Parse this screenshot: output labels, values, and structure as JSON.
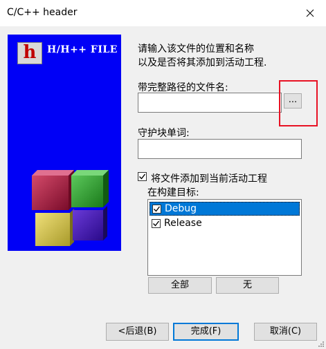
{
  "window": {
    "title": "C/C++ header"
  },
  "side_image": {
    "logo_letter": "h",
    "logo_text": "H/H++ FILE"
  },
  "description": {
    "line1": "请输入该文件的位置和名称",
    "line2": "以及是否将其添加到活动工程."
  },
  "file_path": {
    "label": "带完整路径的文件名:",
    "value": "",
    "browse_label": "..."
  },
  "guard_word": {
    "label": "守护块单词:",
    "value": ""
  },
  "add_to_project": {
    "label": "将文件添加到当前活动工程",
    "checked": true
  },
  "build_targets": {
    "label": "在构建目标:",
    "items": [
      {
        "label": "Debug",
        "checked": true,
        "selected": true
      },
      {
        "label": "Release",
        "checked": true,
        "selected": false
      }
    ],
    "all_label": "全部",
    "none_label": "无"
  },
  "footer": {
    "back_label": "<后退(B)",
    "finish_label": "完成(F)",
    "cancel_label": "取消(C)"
  }
}
